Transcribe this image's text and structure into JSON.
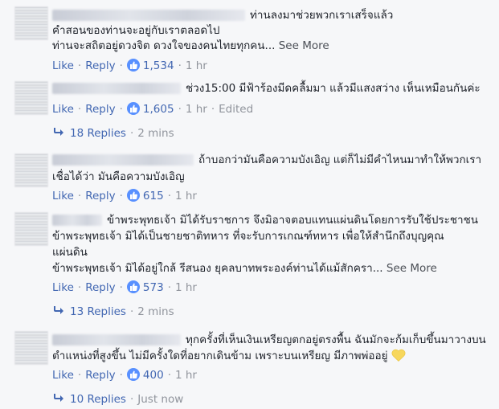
{
  "actions": {
    "like": "Like",
    "reply": "Reply",
    "separator": "·"
  },
  "see_more": "See More",
  "comments": [
    {
      "author": "Sompimat Siwitan",
      "lines": [
        "ท่านลงมาช่วยพวกเราเสร็จแล้ว",
        "คำสอนของท่านจะอยู่กับเราตลอดไป",
        "ท่านจะสถิตอยู่ดวงจิต ดวงใจของคนไทยทุกคน..."
      ],
      "likes": "1,534",
      "time": "1 hr"
    },
    {
      "author": "Pranpa Bodeewuk",
      "lines": [
        "ช่วง15:00 มีฟ้าร้องมีดคลื้มมา แล้วมีแสงสว่าง เห็นเหมือนกันค่ะ"
      ],
      "likes": "1,605",
      "time": "1 hr",
      "edited": "Edited",
      "replies": {
        "label": "18 Replies",
        "time": "2 mins"
      }
    },
    {
      "author": "Nippol Ingprasert",
      "lines": [
        "ถ้าบอกว่ามันคือความบังเอิญ แต่ก็ไม่มีคำไหนมาทำให้พวกเรา",
        "เชื่อได้ว่า มันคือความบังเอิญ"
      ],
      "likes": "615",
      "time": "1 hr"
    },
    {
      "author": "Ina Lyta",
      "lines": [
        "ข้าพระพุทธเจ้า มิได้รับราชการ จึงมิอาจตอบแทนแผ่นดินโดยการรับใช้ประชาชน",
        "ข้าพระพุทธเจ้า มิได้เป็นชายชาติทหาร ที่จะรับการเกณฑ์ทหาร เพื่อให้สำนึกถึงบุญคุณ",
        "แผ่นดิน",
        "ข้าพระพุทธเจ้า มิได้อยู่ใกล้ รีสนอง ยุคลบาทพระองค์ท่านได้แม้สักครา..."
      ],
      "likes": "573",
      "time": "1 hr",
      "replies": {
        "label": "13 Replies",
        "time": "2 mins"
      }
    },
    {
      "author": "Jintarat Amongrat",
      "lines": [
        "ทุกครั้งที่เห็นเงินเหรียญตกอยู่ตรงพื้น ฉันมักจะก้มเก็บขึ้นมาวางบน",
        "ตำแหน่งที่สูงขึ้น ไม่มีครั้งใดที่อยากเดินข้าม เพราะบนเหรียญ มีภาพพ่ออยู่"
      ],
      "likes": "400",
      "time": "1 hr",
      "replies": {
        "label": "10 Replies",
        "time": "Just now"
      }
    }
  ],
  "colors": {
    "link": "#4267b2",
    "meta": "#90949c",
    "like_badge": "#5890ff",
    "heart": "#f7d75c"
  }
}
